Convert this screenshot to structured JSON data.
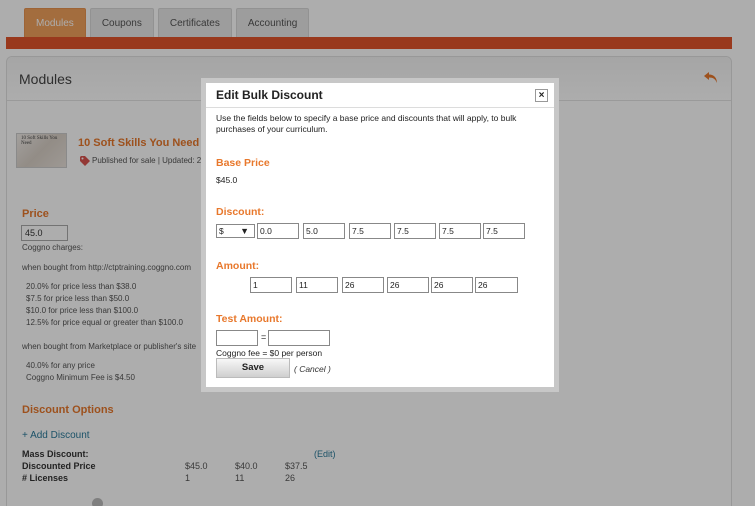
{
  "tabs": [
    "Modules",
    "Coupons",
    "Certificates",
    "Accounting"
  ],
  "page": {
    "title": "Modules",
    "course": {
      "thumb_text": "10 Soft Skills You Need",
      "title": "10 Soft Skills You Need 1",
      "status": "Published for sale | Updated: 2"
    },
    "price": {
      "heading": "Price",
      "value": "45.0",
      "charges_label": "Coggno charges:",
      "bought_from_site": "when bought from http://ctptraining.coggno.com",
      "site_rates": [
        "20.0% for price less than $38.0",
        "$7.5 for price less than $50.0",
        "$10.0 for price less than $100.0",
        "12.5% for price equal or greater than $100.0"
      ],
      "bought_from_market": "when bought from Marketplace or publisher's site",
      "market_rates": [
        "40.0% for any price",
        "Coggno Minimum Fee is $4.50"
      ]
    },
    "discount_options": {
      "heading": "Discount Options",
      "add_label": "+ Add Discount",
      "mass_discount_label": "Mass Discount:",
      "edit_label": "(Edit)",
      "discounted_price_label": "Discounted Price",
      "licenses_label": "# Licenses",
      "discounted_prices": [
        "$45.0",
        "$40.0",
        "$37.5"
      ],
      "licenses": [
        "1",
        "11",
        "26"
      ]
    }
  },
  "modal": {
    "title": "Edit Bulk Discount",
    "close_label": "×",
    "description": "Use the fields below to specify a base price and discounts that will apply, to bulk purchases of your curriculum.",
    "base_price_heading": "Base Price",
    "base_price": "$45.0",
    "discount_heading": "Discount:",
    "discount_type": "$",
    "discounts": [
      "0.0",
      "5.0",
      "7.5",
      "7.5",
      "7.5",
      "7.5"
    ],
    "amount_heading": "Amount:",
    "amounts": [
      "1",
      "11",
      "26",
      "26",
      "26",
      "26"
    ],
    "test_amount_heading": "Test Amount:",
    "test_amount": "",
    "test_result": "",
    "equals": "=",
    "fee_text": "Coggno fee = $0 per person",
    "save_label": "Save",
    "cancel_label": "( Cancel )"
  },
  "colors": {
    "accent": "#e8782c",
    "bar": "#e2542c",
    "active_tab": "#f1a15c"
  }
}
